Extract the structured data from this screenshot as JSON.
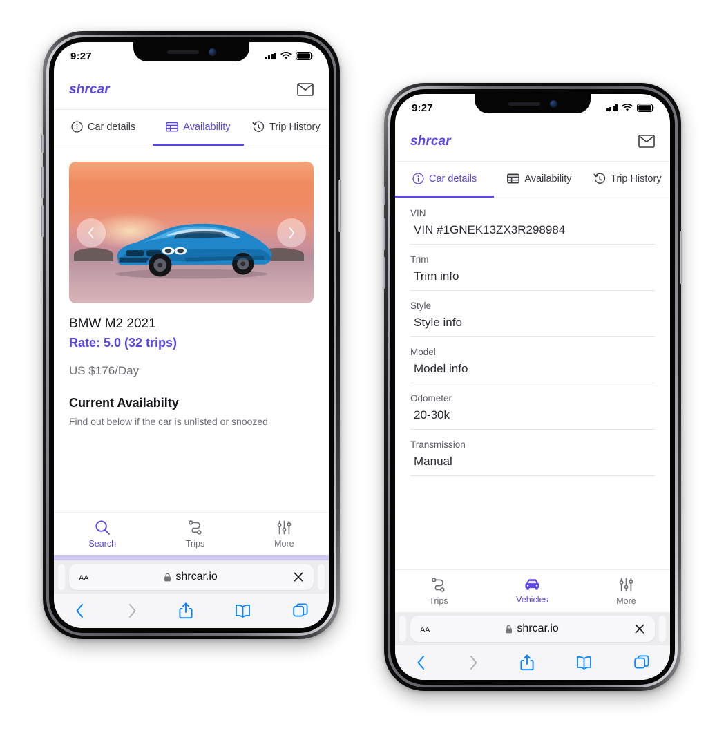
{
  "phones": [
    {
      "id": "left",
      "status": {
        "time": "9:27",
        "signal_icon": "cellular-bars-icon",
        "wifi_icon": "wifi-icon",
        "battery_icon": "battery-icon"
      },
      "header": {
        "brand": "shrcar",
        "mail_icon": "envelope-icon"
      },
      "tabs": [
        {
          "label": "Car details",
          "icon": "info-circle-icon",
          "active": false
        },
        {
          "label": "Availability",
          "icon": "table-icon",
          "active": true
        },
        {
          "label": "Trip History",
          "icon": "history-clock-icon",
          "active": false
        }
      ],
      "carousel": {
        "prev_icon": "chevron-left-icon",
        "next_icon": "chevron-right-icon",
        "alt": "blue-bmw-m2-at-sunset"
      },
      "listing": {
        "title": "BMW M2 2021",
        "rate": "Rate: 5.0 (32 trips)",
        "price": "US $176/Day",
        "availability_heading": "Current Availabilty",
        "availability_sub": "Find out below if the car is unlisted or snoozed"
      },
      "appnav": [
        {
          "label": "Search",
          "icon": "search-icon",
          "active": true
        },
        {
          "label": "Trips",
          "icon": "route-icon",
          "active": false
        },
        {
          "label": "More",
          "icon": "sliders-icon",
          "active": false
        }
      ],
      "safari": {
        "aa_label": "AA",
        "lock_icon": "lock-icon",
        "url": "shrcar.io",
        "close_icon": "close-icon",
        "toolbar": [
          {
            "icon": "back-chevron-icon",
            "enabled": true
          },
          {
            "icon": "forward-chevron-icon",
            "enabled": false
          },
          {
            "icon": "share-icon",
            "enabled": true
          },
          {
            "icon": "bookmarks-book-icon",
            "enabled": true
          },
          {
            "icon": "tabs-icon",
            "enabled": true
          }
        ]
      }
    },
    {
      "id": "right",
      "status": {
        "time": "9:27",
        "signal_icon": "cellular-bars-icon",
        "wifi_icon": "wifi-icon",
        "battery_icon": "battery-icon"
      },
      "header": {
        "brand": "shrcar",
        "mail_icon": "envelope-icon"
      },
      "tabs": [
        {
          "label": "Car details",
          "icon": "info-circle-icon",
          "active": true
        },
        {
          "label": "Availability",
          "icon": "table-icon",
          "active": false
        },
        {
          "label": "Trip History",
          "icon": "history-clock-icon",
          "active": false
        }
      ],
      "fields": [
        {
          "label": "VIN",
          "value": "VIN #1GNEK13ZX3R298984"
        },
        {
          "label": "Trim",
          "value": "Trim info"
        },
        {
          "label": "Style",
          "value": "Style info"
        },
        {
          "label": "Model",
          "value": "Model info"
        },
        {
          "label": "Odometer",
          "value": "20-30k"
        },
        {
          "label": "Transmission",
          "value": "Manual"
        }
      ],
      "appnav": [
        {
          "label": "Trips",
          "icon": "route-icon",
          "active": false
        },
        {
          "label": "Vehicles",
          "icon": "car-icon",
          "active": true
        },
        {
          "label": "More",
          "icon": "sliders-icon",
          "active": false
        }
      ],
      "safari": {
        "aa_label": "AA",
        "lock_icon": "lock-icon",
        "url": "shrcar.io",
        "close_icon": "close-icon",
        "toolbar": [
          {
            "icon": "back-chevron-icon",
            "enabled": true
          },
          {
            "icon": "forward-chevron-icon",
            "enabled": false
          },
          {
            "icon": "share-icon",
            "enabled": true
          },
          {
            "icon": "bookmarks-book-icon",
            "enabled": true
          },
          {
            "icon": "tabs-icon",
            "enabled": true
          }
        ]
      }
    }
  ],
  "colors": {
    "accent_purple": "#5948e6",
    "safari_blue": "#0a84ff",
    "text_dark": "#15151a",
    "text_muted": "#6e6e75"
  }
}
